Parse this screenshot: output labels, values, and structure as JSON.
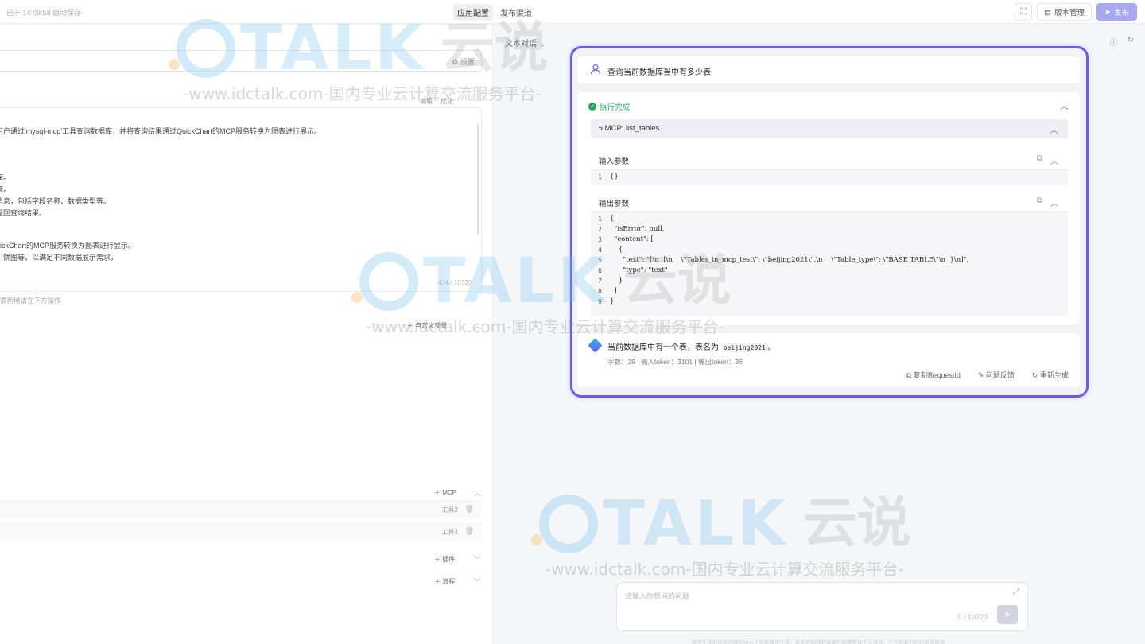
{
  "topbar": {
    "autosave": "已于 14:09:58 自动保存",
    "tabs": [
      "应用配置",
      "发布渠道"
    ],
    "version_label": "版本管理",
    "publish_label": "发布"
  },
  "left": {
    "settings_label": "设置",
    "prompt_actions": [
      "编辑",
      "优化"
    ],
    "prompt_lines": [
      "用户通过'mysql-mcp'工具查询数据库，并将查询结果通过QuickChart的MCP服务转换为图表进行展示。",
      "库。",
      "表。",
      "信息，包括字段名称、数据类型等。",
      "返回查询结果。",
      "uickChart的MCP服务转换为图表进行显示。",
      "、饼图等，以满足不同数据展示需求。"
    ],
    "prompt_count": "434 / 10720",
    "prompt_hint": "需新增请在下方操作",
    "custom_var_label": "自定义变量",
    "mcp_label": "MCP",
    "tools": [
      "工具2",
      "工具4"
    ],
    "plugin_label": "插件",
    "flow_label": "流程"
  },
  "right": {
    "mode": "文本对话",
    "user_question": "查询当前数据库当中有多少表",
    "exec_status": "执行完成",
    "mcp_call": "MCP: list_tables",
    "input_title": "输入参数",
    "input_code": [
      "{}"
    ],
    "output_title": "输出参数",
    "output_code": [
      "{",
      "  \"isError\": null,",
      "  \"content\": [",
      "    {",
      "      \"text\": \"[\\n  [\\n    \\\"Tables_in_mcp_test\\\": \\\"beijing2021\\\",\\n    \\\"Table_type\\\": \\\"BASE TABLE\\\"\\n  }\\n]\",",
      "      \"type\": \"text\"",
      "    }",
      "  ]",
      "}"
    ],
    "answer_prefix": "当前数据库中有一个表，表名为",
    "answer_code": "beijing2021",
    "answer_suffix": "。",
    "answer_stats": "字数：29  |  输入token：3101  |  输出token：36",
    "actions": [
      "复制RequestId",
      "问题反馈",
      "重新生成"
    ],
    "input_placeholder": "请输入你想问的问题",
    "input_count": "0 / 10720",
    "disclaimer": "服务生成的所有内容均由人工智能模型生成，其生成内容的准确性和完整性无法保证，不代表我们的态度或观点"
  },
  "watermark": {
    "brand": "TALK",
    "cn": "云说",
    "url": "-www.idctalk.com-国内专业云计算交流服务平台-"
  },
  "colors": {
    "accent": "#6c5ce7",
    "success": "#20a35a",
    "publish": "#a8a8f0"
  }
}
